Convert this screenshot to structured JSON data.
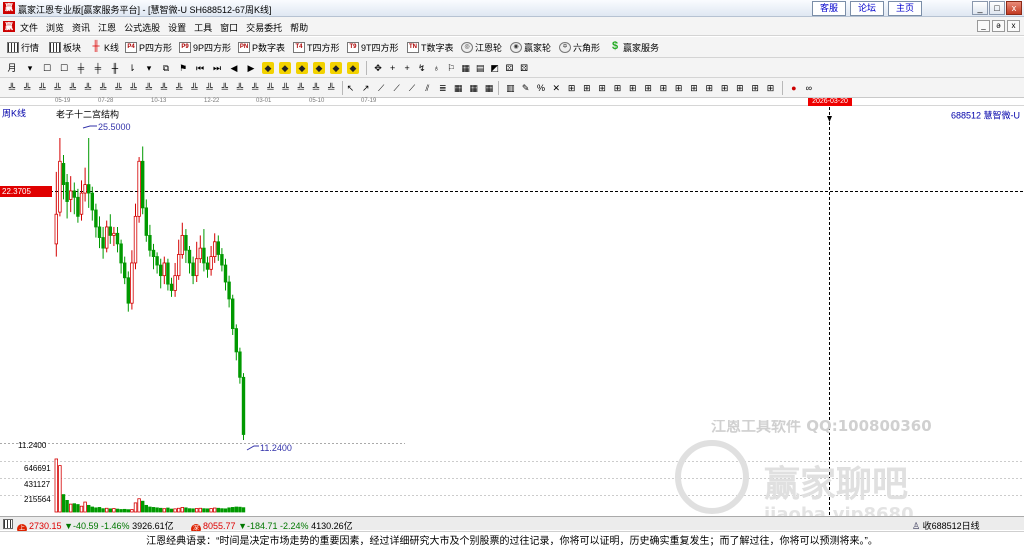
{
  "window": {
    "title": "赢家江恩专业版[赢家服务平台] - [慧智微-U  SH688512-67周K线]",
    "links": [
      "客服",
      "论坛",
      "主页"
    ],
    "controls": [
      "_",
      "□",
      "x"
    ]
  },
  "menu": {
    "items": [
      "文件",
      "浏览",
      "资讯",
      "江恩",
      "公式选股",
      "设置",
      "工具",
      "窗口",
      "交易委托",
      "帮助"
    ],
    "mdi_controls": [
      "_",
      "ə",
      "x"
    ]
  },
  "toolbar1": {
    "buttons": [
      {
        "label": "行情",
        "icon": "grid-icon"
      },
      {
        "label": "板块",
        "icon": "block-icon"
      },
      {
        "label": "K线",
        "icon": "candle-icon"
      },
      {
        "label": "P四方形",
        "icon": "p-square-icon",
        "tag": "P4"
      },
      {
        "label": "9P四方形",
        "icon": "9p-square-icon",
        "tag": "P9"
      },
      {
        "label": "P数字表",
        "icon": "p-number-table-icon",
        "tag": "PN"
      },
      {
        "label": "T四方形",
        "icon": "t-square-icon",
        "tag": "T4"
      },
      {
        "label": "9T四方形",
        "icon": "9t-square-icon",
        "tag": "T9"
      },
      {
        "label": "T数字表",
        "icon": "t-number-table-icon",
        "tag": "TN"
      },
      {
        "label": "江恩轮",
        "icon": "gann-wheel-icon"
      },
      {
        "label": "赢家轮",
        "icon": "winner-wheel-icon"
      },
      {
        "label": "六角形",
        "icon": "hexagon-icon"
      },
      {
        "label": "赢家服务",
        "icon": "dollar-icon"
      }
    ]
  },
  "datebar": {
    "dates": [
      "05-19",
      "07-28",
      "10-13",
      "12-22",
      "03-01",
      "05-10",
      "07-19"
    ],
    "cursor_date": "2026-03-20"
  },
  "chart": {
    "period_label": "周K线",
    "structure_label": "老子十二宫结构",
    "stock_label": "688512 慧智微-U",
    "high_label": "25.5000",
    "low_label": "11.2400",
    "cursor_price": "22.3705",
    "axis_low": "11.2400",
    "volume_ticks": [
      "646691",
      "431127",
      "215564"
    ],
    "colors": {
      "up": "#d40000",
      "down": "#009900",
      "cursor": "#000000",
      "cursor_tag": "#e00000",
      "annotation": "#3333aa"
    },
    "watermark_text1": "江恩工具软件 QQ:100800360",
    "watermark_text2": "赢家聊吧",
    "watermark_text3": "jiaoba.vip8680"
  },
  "chart_data": {
    "type": "candlestick",
    "price_range": [
      11.24,
      25.5
    ],
    "candles": [
      {
        "o": 20.5,
        "c": 21.9,
        "h": 23.9,
        "l": 19.9
      },
      {
        "o": 22.0,
        "c": 24.4,
        "h": 25.5,
        "l": 21.8
      },
      {
        "o": 24.3,
        "c": 23.3,
        "h": 24.7,
        "l": 22.6
      },
      {
        "o": 23.4,
        "c": 22.5,
        "h": 23.8,
        "l": 21.7
      },
      {
        "o": 22.6,
        "c": 23.0,
        "h": 23.7,
        "l": 22.0
      },
      {
        "o": 23.0,
        "c": 22.7,
        "h": 23.4,
        "l": 21.9
      },
      {
        "o": 22.7,
        "c": 21.8,
        "h": 23.1,
        "l": 21.5
      },
      {
        "o": 21.9,
        "c": 22.9,
        "h": 23.5,
        "l": 21.6
      },
      {
        "o": 22.9,
        "c": 23.3,
        "h": 24.1,
        "l": 22.5
      },
      {
        "o": 23.3,
        "c": 22.9,
        "h": 25.5,
        "l": 22.2
      },
      {
        "o": 22.9,
        "c": 22.1,
        "h": 23.2,
        "l": 21.6
      },
      {
        "o": 22.1,
        "c": 21.3,
        "h": 22.4,
        "l": 20.8
      },
      {
        "o": 21.3,
        "c": 20.8,
        "h": 21.8,
        "l": 20.3
      },
      {
        "o": 20.8,
        "c": 20.3,
        "h": 21.3,
        "l": 19.8
      },
      {
        "o": 20.3,
        "c": 21.3,
        "h": 21.6,
        "l": 20.1
      },
      {
        "o": 21.3,
        "c": 20.9,
        "h": 21.9,
        "l": 20.5
      },
      {
        "o": 20.9,
        "c": 21.0,
        "h": 21.3,
        "l": 20.4
      },
      {
        "o": 21.0,
        "c": 20.5,
        "h": 21.3,
        "l": 20.1
      },
      {
        "o": 20.5,
        "c": 19.6,
        "h": 20.7,
        "l": 19.1
      },
      {
        "o": 19.6,
        "c": 18.9,
        "h": 19.9,
        "l": 18.6
      },
      {
        "o": 18.9,
        "c": 17.7,
        "h": 19.2,
        "l": 17.3
      },
      {
        "o": 17.7,
        "c": 19.6,
        "h": 20.2,
        "l": 17.4
      },
      {
        "o": 19.6,
        "c": 21.8,
        "h": 22.4,
        "l": 19.3
      },
      {
        "o": 21.8,
        "c": 24.4,
        "h": 24.6,
        "l": 21.5
      },
      {
        "o": 24.4,
        "c": 22.2,
        "h": 25.1,
        "l": 21.9
      },
      {
        "o": 22.2,
        "c": 20.9,
        "h": 22.6,
        "l": 20.6
      },
      {
        "o": 20.9,
        "c": 20.2,
        "h": 21.4,
        "l": 19.9
      },
      {
        "o": 20.2,
        "c": 19.9,
        "h": 20.5,
        "l": 19.3
      },
      {
        "o": 19.9,
        "c": 19.5,
        "h": 20.1,
        "l": 19.1
      },
      {
        "o": 19.5,
        "c": 19.0,
        "h": 19.8,
        "l": 18.4
      },
      {
        "o": 19.0,
        "c": 19.6,
        "h": 19.9,
        "l": 18.6
      },
      {
        "o": 19.6,
        "c": 18.6,
        "h": 19.8,
        "l": 18.3
      },
      {
        "o": 18.6,
        "c": 18.3,
        "h": 18.9,
        "l": 18.0
      },
      {
        "o": 18.3,
        "c": 19.0,
        "h": 19.6,
        "l": 18.0
      },
      {
        "o": 19.0,
        "c": 20.0,
        "h": 20.7,
        "l": 18.8
      },
      {
        "o": 20.0,
        "c": 20.9,
        "h": 21.5,
        "l": 19.8
      },
      {
        "o": 20.9,
        "c": 20.2,
        "h": 21.2,
        "l": 19.6
      },
      {
        "o": 20.2,
        "c": 19.6,
        "h": 20.4,
        "l": 19.1
      },
      {
        "o": 19.6,
        "c": 19.0,
        "h": 19.9,
        "l": 18.6
      },
      {
        "o": 19.0,
        "c": 19.8,
        "h": 20.6,
        "l": 18.7
      },
      {
        "o": 19.8,
        "c": 20.3,
        "h": 20.9,
        "l": 19.6
      },
      {
        "o": 20.3,
        "c": 19.6,
        "h": 21.2,
        "l": 19.2
      },
      {
        "o": 19.6,
        "c": 19.3,
        "h": 19.9,
        "l": 18.9
      },
      {
        "o": 19.3,
        "c": 19.9,
        "h": 20.4,
        "l": 19.0
      },
      {
        "o": 19.9,
        "c": 20.6,
        "h": 21.0,
        "l": 19.6
      },
      {
        "o": 20.6,
        "c": 20.0,
        "h": 20.9,
        "l": 19.7
      },
      {
        "o": 20.0,
        "c": 19.5,
        "h": 20.3,
        "l": 19.2
      },
      {
        "o": 19.5,
        "c": 18.7,
        "h": 19.8,
        "l": 18.3
      },
      {
        "o": 18.7,
        "c": 17.9,
        "h": 19.0,
        "l": 17.5
      },
      {
        "o": 17.9,
        "c": 16.5,
        "h": 18.1,
        "l": 16.2
      },
      {
        "o": 16.5,
        "c": 15.4,
        "h": 16.7,
        "l": 15.0
      },
      {
        "o": 15.4,
        "c": 14.2,
        "h": 15.6,
        "l": 13.9
      },
      {
        "o": 14.2,
        "c": 11.5,
        "h": 14.4,
        "l": 11.24
      }
    ],
    "volume": [
      640000,
      560000,
      210000,
      140000,
      95000,
      100000,
      90000,
      70000,
      120000,
      80000,
      60000,
      50000,
      55000,
      40000,
      45000,
      38000,
      42000,
      35000,
      30000,
      32000,
      28000,
      30000,
      110000,
      160000,
      130000,
      80000,
      60000,
      55000,
      50000,
      45000,
      40000,
      48000,
      35000,
      38000,
      45000,
      55000,
      50000,
      40000,
      38000,
      42000,
      45000,
      40000,
      38000,
      42000,
      48000,
      45000,
      40000,
      38000,
      50000,
      55000,
      60000,
      58000,
      52000
    ]
  },
  "ticker": [
    {
      "icon": "上",
      "value": "2730.15",
      "change": "▼-40.59",
      "pct": "-1.46%",
      "amount": "3926.61亿"
    },
    {
      "icon": "深",
      "value": "8055.77",
      "change": "▼-184.71",
      "pct": "-2.24%",
      "amount": "4130.26亿"
    }
  ],
  "ticker_right": "收688512日线",
  "quote": "江恩经典语录：“时间是决定市场走势的重要因素，经过详细研究大市及个别股票的过往记录，你将可以证明，历史确实重复发生；而了解过往，你将可以预测将来。”。"
}
